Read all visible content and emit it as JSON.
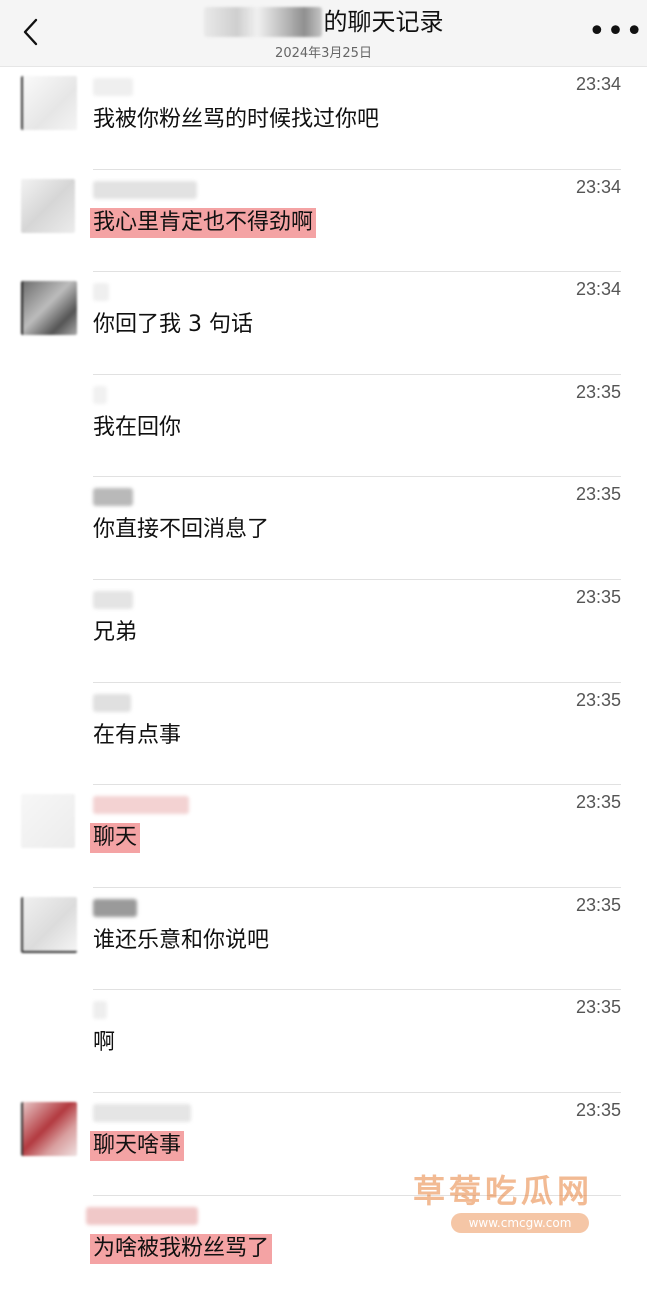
{
  "header": {
    "title_suffix": "的聊天记录",
    "date": "2024年3月25日",
    "more_label": "•••"
  },
  "messages": [
    {
      "time": "23:34",
      "text": "我被你粉丝骂的时候找过你吧",
      "highlighted": false
    },
    {
      "time": "23:34",
      "text": "我心里肯定也不得劲啊",
      "highlighted": true
    },
    {
      "time": "23:34",
      "text": "你回了我 3 句话",
      "highlighted": false
    },
    {
      "time": "23:35",
      "text": "我在回你",
      "highlighted": false
    },
    {
      "time": "23:35",
      "text": "你直接不回消息了",
      "highlighted": false
    },
    {
      "time": "23:35",
      "text": "兄弟",
      "highlighted": false
    },
    {
      "time": "23:35",
      "text": "在有点事",
      "highlighted": false
    },
    {
      "time": "23:35",
      "text": "聊天",
      "highlighted": true
    },
    {
      "time": "23:35",
      "text": "谁还乐意和你说吧",
      "highlighted": false
    },
    {
      "time": "23:35",
      "text": "啊",
      "highlighted": false
    },
    {
      "time": "23:35",
      "text": "聊天啥事",
      "highlighted": true
    },
    {
      "time": "",
      "text": "为啥被我粉丝骂了",
      "highlighted": true
    }
  ],
  "watermark": {
    "title": "草莓吃瓜网",
    "url": "www.cmcgw.com"
  },
  "colors": {
    "highlight": "#f4a3a4",
    "header_bg": "#f5f5f5",
    "watermark": "#e8813a"
  }
}
